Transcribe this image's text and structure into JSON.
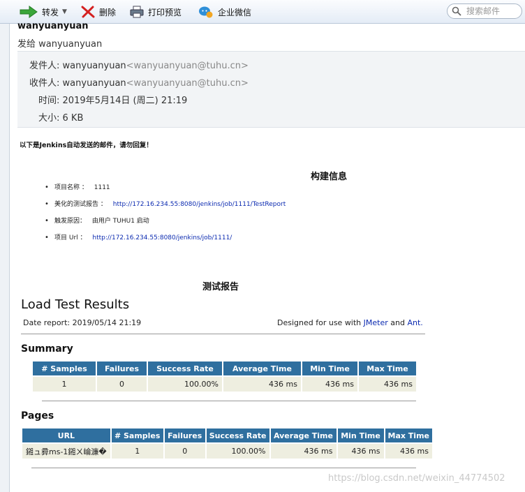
{
  "toolbar": {
    "forward_label": "转发",
    "delete_label": "删除",
    "print_label": "打印预览",
    "wechat_label": "企业微信",
    "search_placeholder": "搜索邮件"
  },
  "header": {
    "sender_name": "wanyuanyuan",
    "to_line": "发给 wanyuanyuan",
    "from_label": "发件人:",
    "from_name": "wanyuanyuan",
    "from_addr": "<wanyuanyuan@tuhu.cn>",
    "recipient_label": "收件人:",
    "recipient_name": "wanyuanyuan",
    "recipient_addr": "<wanyuanyuan@tuhu.cn>",
    "time_label": "时间:",
    "time_value": "2019年5月14日 (周二) 21:19",
    "size_label": "大小:",
    "size_value": "6 KB"
  },
  "body": {
    "intro": "以下是Jenkins自动发送的邮件，请勿回复！",
    "build_title": "构建信息",
    "build_items": [
      {
        "label": "项目名称 ：",
        "value": "1111"
      },
      {
        "label": "美化的测试报告 ：",
        "link": "http://172.16.234.55:8080/jenkins/job/1111/TestReport"
      },
      {
        "label": "触发原因：",
        "value": "由用户 TUHU1 启动"
      },
      {
        "label": "项目 Url ：",
        "link": "http://172.16.234.55:8080/jenkins/job/1111/"
      }
    ],
    "report_title": "测试报告",
    "load_title": "Load Test Results",
    "date_report": "Date report: 2019/05/14 21:19",
    "designed_prefix": "Designed for use with",
    "designed_jmeter": "JMeter",
    "designed_and": "and",
    "designed_ant": "Ant."
  },
  "summary": {
    "title": "Summary",
    "headers": [
      "# Samples",
      "Failures",
      "Success Rate",
      "Average Time",
      "Min Time",
      "Max Time"
    ],
    "row": [
      "1",
      "0",
      "100.00%",
      "436 ms",
      "436 ms",
      "436 ms"
    ]
  },
  "pages": {
    "title": "Pages",
    "headers": [
      "URL",
      "# Samples",
      "Failures",
      "Success Rate",
      "Average Time",
      "Min Time",
      "Max Time"
    ],
    "row": [
      "鎺ュ彛ms-1鎺ㄨ崘濂�",
      "1",
      "0",
      "100.00%",
      "436 ms",
      "436 ms",
      "436 ms"
    ]
  },
  "watermark": "https://blog.csdn.net/weixin_44774502",
  "colors": {
    "table_header": "#2f6f9f",
    "table_cell": "#eeeee0",
    "link": "#0b2ab0"
  }
}
